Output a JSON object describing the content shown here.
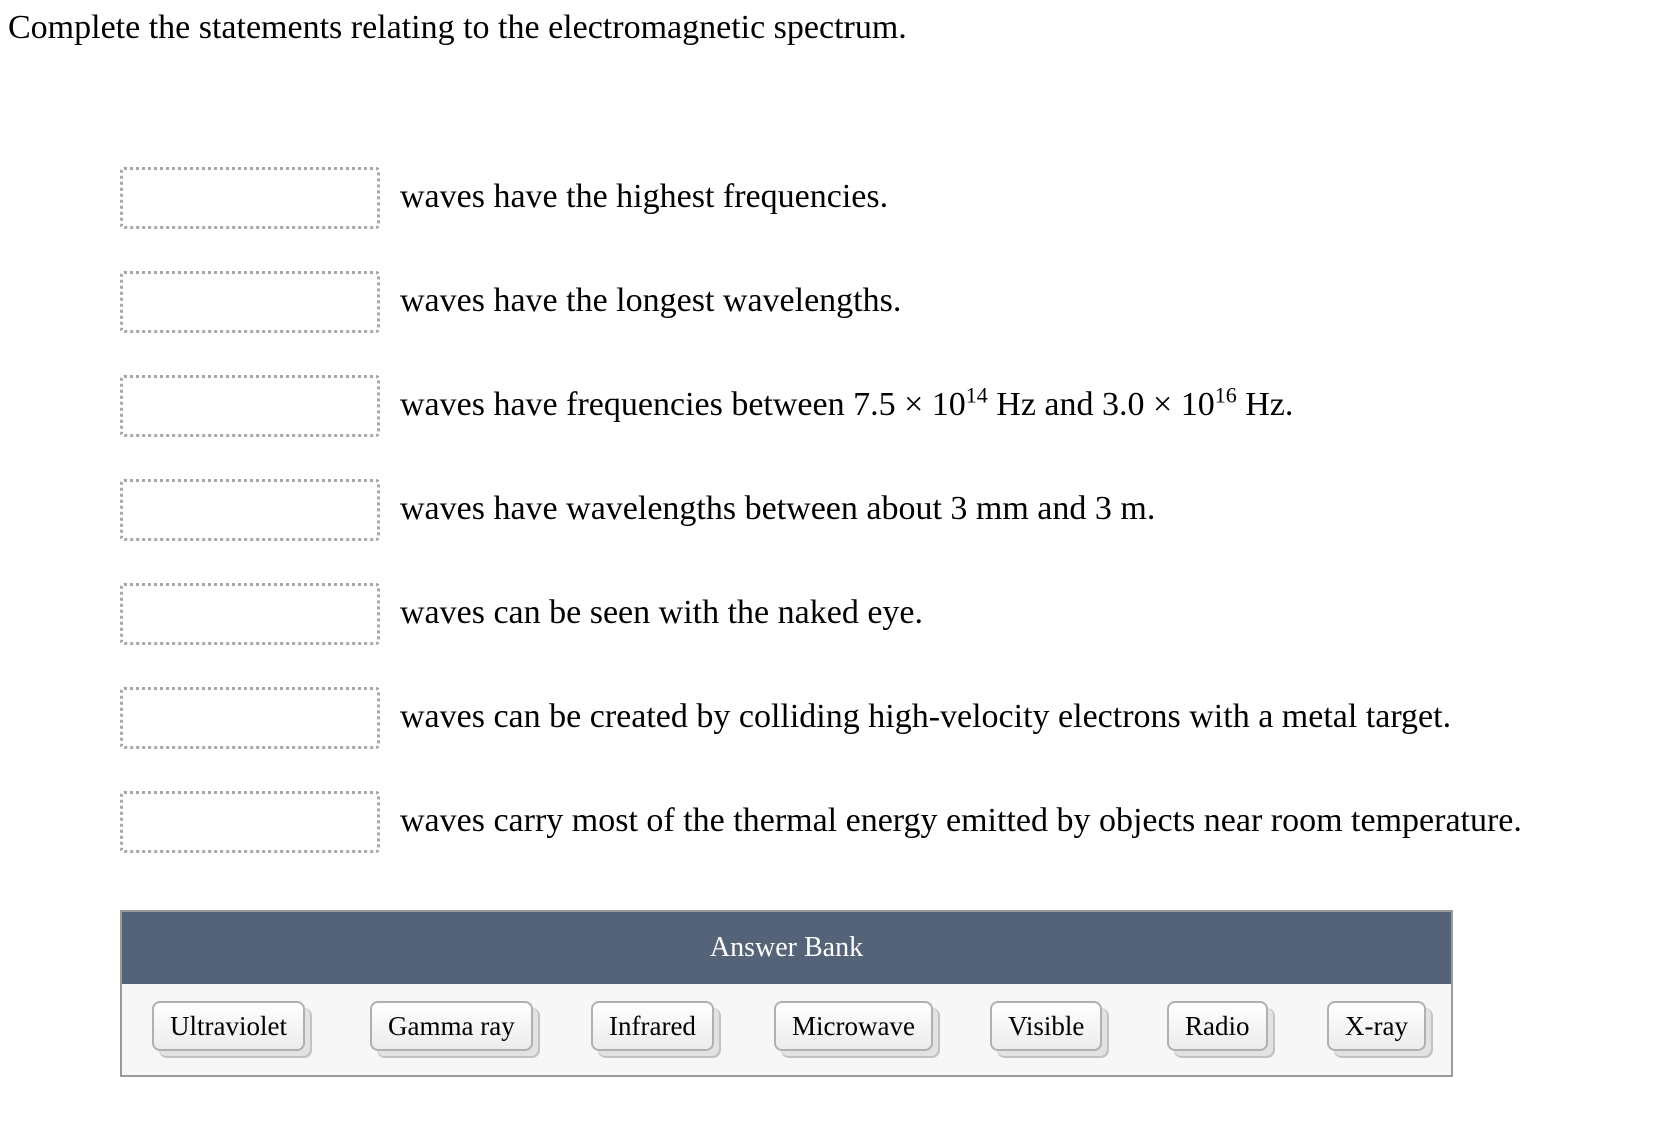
{
  "prompt": "Complete the statements relating to the electromagnetic spectrum.",
  "statements": [
    {
      "blank": "",
      "text": "waves have the highest frequencies."
    },
    {
      "blank": "",
      "text": "waves have the longest wavelengths."
    },
    {
      "blank": "",
      "text_parts": [
        "waves have frequencies between 7.5 × 10",
        "14",
        " Hz and 3.0 × 10",
        "16",
        " Hz."
      ]
    },
    {
      "blank": "",
      "text": "waves have wavelengths between about 3 mm and 3 m."
    },
    {
      "blank": "",
      "text": "waves can be seen with the naked eye."
    },
    {
      "blank": "",
      "text": "waves can be created by colliding high-velocity electrons with a metal target."
    },
    {
      "blank": "",
      "text": "waves carry most of the thermal energy emitted by objects near room temperature."
    }
  ],
  "answer_bank": {
    "title": "Answer Bank",
    "header_color": "#546378",
    "items": [
      "Ultraviolet",
      "Gamma ray",
      "Infrared",
      "Microwave",
      "Visible",
      "Radio",
      "X-ray"
    ]
  }
}
